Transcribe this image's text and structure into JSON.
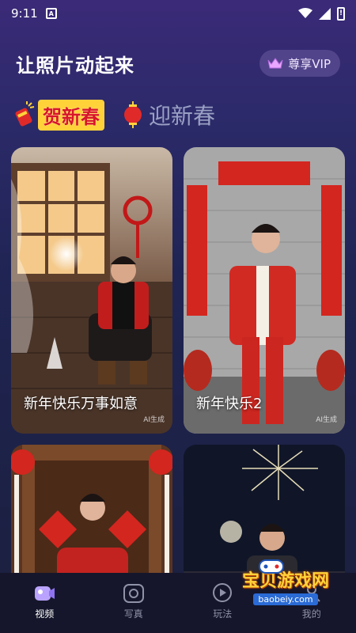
{
  "status_bar": {
    "time": "9:11",
    "app_icon_letter": "A",
    "icons": [
      "wifi-icon",
      "signal-icon",
      "battery-icon"
    ]
  },
  "header": {
    "title": "让照片动起来",
    "vip_label": "尊享VIP"
  },
  "categories": [
    {
      "label": "贺新春",
      "active": true,
      "icon": "firecracker-icon"
    },
    {
      "label": "迎新春",
      "active": false,
      "icon": "lantern-icon"
    }
  ],
  "cards": [
    {
      "title": "新年快乐万事如意",
      "ai_badge": "AI生成"
    },
    {
      "title": "新年快乐2",
      "ai_badge": "AI生成"
    },
    {
      "title": "",
      "ai_badge": ""
    },
    {
      "title": "",
      "ai_badge": ""
    }
  ],
  "tabs": [
    {
      "label": "视频",
      "icon": "video-icon",
      "active": true
    },
    {
      "label": "写真",
      "icon": "camera-icon",
      "active": false
    },
    {
      "label": "玩法",
      "icon": "play-icon",
      "active": false
    },
    {
      "label": "我的",
      "icon": "profile-icon",
      "active": false
    }
  ],
  "watermark": {
    "text": "宝贝游戏网",
    "url": "baobeiy.com"
  },
  "colors": {
    "accent_yellow": "#ffd23a",
    "accent_red": "#d8152a",
    "tab_bar_bg": "#15162b"
  }
}
